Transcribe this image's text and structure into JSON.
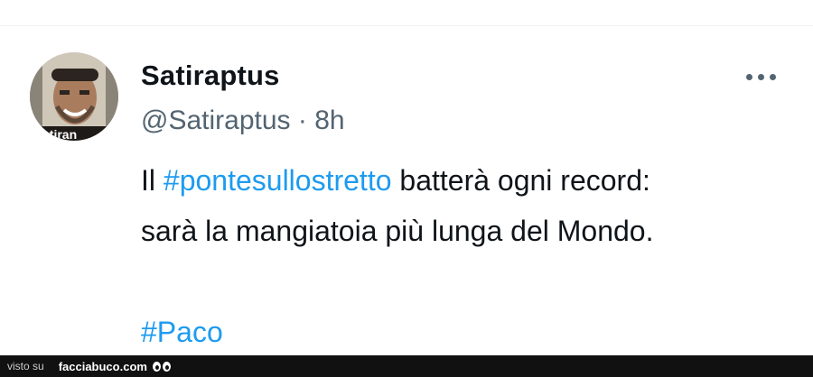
{
  "tweet": {
    "display_name": "Satiraptus",
    "handle": "@Satiraptus",
    "separator": "·",
    "time": "8h",
    "lines": [
      {
        "prefix": "Il ",
        "hashtag": "#pontesullostretto",
        "suffix": " batterà ogni record:"
      },
      {
        "text": "sarà la mangiatoia più lunga del Mondo."
      }
    ],
    "hashtag_line": "#Paco",
    "avatar_caption": "atiran"
  },
  "footer": {
    "visto_su": "visto su",
    "brand": "facciabuco.com"
  },
  "colors": {
    "hashtag": "#1d9bf0",
    "text": "#0f1419",
    "secondary": "#536471",
    "footer_bg": "#111111"
  }
}
